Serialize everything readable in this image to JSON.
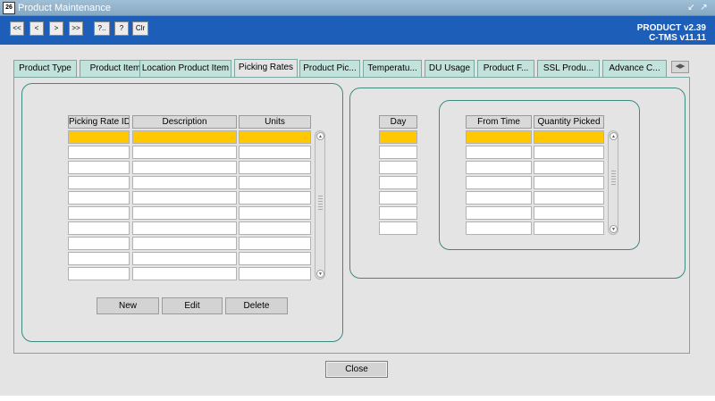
{
  "window": {
    "title": "Product Maintenance",
    "app_icon_text": "26",
    "restore_symbol": "↙",
    "maximize_symbol": "↗"
  },
  "toolbar": {
    "buttons": [
      {
        "label": "<<"
      },
      {
        "label": "<"
      },
      {
        "label": ">"
      },
      {
        "label": ">>"
      },
      {
        "label": "?.."
      },
      {
        "label": "?"
      },
      {
        "label": "Clr"
      }
    ],
    "version_line1": "PRODUCT v2.39",
    "version_line2": "C-TMS v11.11"
  },
  "tabs": [
    {
      "label": "Product Type",
      "active": false
    },
    {
      "label": "Product Item",
      "active": false
    },
    {
      "label": "Location Product Item",
      "active": false
    },
    {
      "label": "Picking Rates",
      "active": true
    },
    {
      "label": "Product Pic...",
      "active": false
    },
    {
      "label": "Temperatu...",
      "active": false
    },
    {
      "label": "DU Usage",
      "active": false
    },
    {
      "label": "Product F...",
      "active": false
    },
    {
      "label": "SSL Produ...",
      "active": false
    },
    {
      "label": "Advance C...",
      "active": false
    }
  ],
  "tab_scroll_symbol": "◀▶",
  "rates_table": {
    "columns": [
      "Picking Rate ID",
      "Description",
      "Units"
    ],
    "row_count": 10,
    "selected_row": 0
  },
  "day_table": {
    "columns": [
      "Day"
    ],
    "row_count": 7,
    "selected_row": 0
  },
  "time_table": {
    "columns": [
      "From Time",
      "Quantity Picked"
    ],
    "row_count": 7,
    "selected_row": 0
  },
  "scroll": {
    "up_symbol": "▲",
    "down_symbol": "▼"
  },
  "actions": {
    "new_label": "New",
    "edit_label": "Edit",
    "delete_label": "Delete",
    "close_label": "Close"
  },
  "colors": {
    "toolbar_bg": "#1d5fb8",
    "tab_bg": "#c2e3dc",
    "selected_row": "#ffc800",
    "group_border": "#3d8a80"
  }
}
